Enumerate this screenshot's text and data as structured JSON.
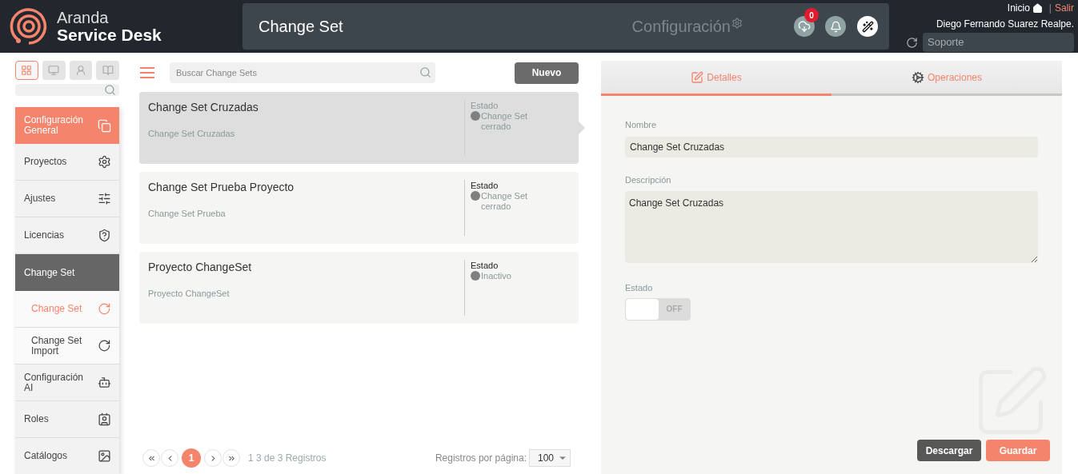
{
  "header": {
    "brand_line1": "Aranda",
    "brand_line2": "Service Desk",
    "page_title": "Change Set",
    "section_label": "Configuración",
    "download_badge": "0",
    "home_link": "Inicio",
    "separator": "|",
    "logout_link": "Salir",
    "user_name": "Diego Fernando Suarez Realpe.",
    "project_field": "Soporte"
  },
  "sidebar": {
    "views": [
      {
        "selected": true
      },
      {
        "selected": false
      },
      {
        "selected": false
      },
      {
        "selected": false
      }
    ],
    "items": [
      {
        "label": "Configuración General",
        "kind": "section",
        "selected": true
      },
      {
        "label": "Proyectos",
        "kind": "item",
        "selected": false
      },
      {
        "label": "Ajustes",
        "kind": "item",
        "selected": false
      },
      {
        "label": "Licencias",
        "kind": "item",
        "selected": false
      },
      {
        "label": "Change Set",
        "kind": "group",
        "selected": false
      },
      {
        "label": "Change Set",
        "kind": "subitem",
        "selected": true
      },
      {
        "label": "Change Set Import",
        "kind": "subitem",
        "selected": false
      },
      {
        "label": "Configuración AI",
        "kind": "item",
        "selected": false
      },
      {
        "label": "Roles",
        "kind": "item",
        "selected": false
      },
      {
        "label": "Catálogos",
        "kind": "item",
        "selected": false
      }
    ]
  },
  "list": {
    "search_placeholder": "Buscar Change Sets",
    "new_button": "Nuevo",
    "cards": [
      {
        "title": "Change Set Cruzadas",
        "subtitle": "Change Set Cruzadas",
        "status_label": "Estado",
        "status": "Change Set cerrado",
        "selected": true
      },
      {
        "title": "Change Set Prueba Proyecto",
        "subtitle": "Change Set Prueba",
        "status_label": "Estado",
        "status": "Change Set cerrado",
        "selected": false
      },
      {
        "title": "Proyecto ChangeSet",
        "subtitle": "Proyecto ChangeSet",
        "status_label": "Estado",
        "status": "Inactivo",
        "selected": false
      }
    ],
    "pagination": {
      "pages": [
        {
          "label": "1",
          "selected": true
        }
      ],
      "summary": "1 3 de 3 Registros",
      "per_page_label": "Registros por página:",
      "per_page": "100"
    }
  },
  "details": {
    "tabs": [
      {
        "label": "Detalles",
        "selected": true
      },
      {
        "label": "Operaciones",
        "selected": false
      }
    ],
    "name_label": "Nombre",
    "name_value": "Change Set Cruzadas",
    "description_label": "Descripción",
    "description_value": "Change Set Cruzadas",
    "state_label": "Estado",
    "state": {
      "on": false,
      "off_label": "OFF"
    },
    "buttons": [
      "Descargar",
      "Guardar"
    ]
  }
}
